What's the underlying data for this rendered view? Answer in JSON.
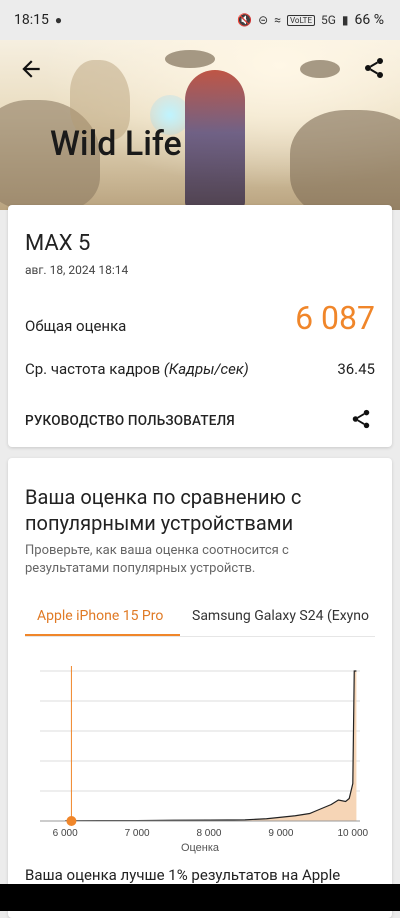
{
  "status_bar": {
    "time": "18:15",
    "battery": "66 %",
    "network": "5G",
    "volte": "VoLTE"
  },
  "hero": {
    "title": "Wild Life"
  },
  "result_card": {
    "device_name": "MAX 5",
    "date": "авг. 18, 2024 18:14",
    "score_label": "Общая оценка",
    "score_value": "6 087",
    "fps_label_prefix": "Ср. частота кадров ",
    "fps_label_unit": "(Кадры/сек)",
    "fps_value": "36.45",
    "guide_label": "РУКОВОДСТВО ПОЛЬЗОВАТЕЛЯ"
  },
  "comparison": {
    "title": "Ваша оценка по сравнению с популярными устройствами",
    "subtitle": "Проверьте, как ваша оценка соотносится с результатами популярных устройств.",
    "tabs": [
      "Apple iPhone 15 Pro",
      "Samsung Galaxy S24 (Exyno"
    ],
    "active_tab": 0,
    "better_text": "Ваша оценка лучше 1% результатов на Apple"
  },
  "colors": {
    "accent": "#f0862a"
  },
  "chart_data": {
    "type": "area",
    "xlabel": "Оценка",
    "ylabel": "",
    "xlim": [
      5650,
      10100
    ],
    "tick_labels": [
      "6 000",
      "7 000",
      "8 000",
      "9 000",
      "10 000"
    ],
    "tick_values": [
      6000,
      7000,
      8000,
      9000,
      10000
    ],
    "user_score": 6087,
    "grid": true,
    "x": [
      6000,
      6500,
      7000,
      7500,
      8000,
      8500,
      8800,
      9000,
      9200,
      9400,
      9500,
      9600,
      9700,
      9800,
      9900,
      9950,
      10000,
      10020,
      10050
    ],
    "y": [
      0.2,
      0.3,
      0.3,
      0.5,
      0.6,
      0.8,
      1.5,
      2.5,
      3.5,
      5,
      7,
      9,
      11,
      14,
      13,
      15,
      25,
      100,
      100
    ]
  }
}
